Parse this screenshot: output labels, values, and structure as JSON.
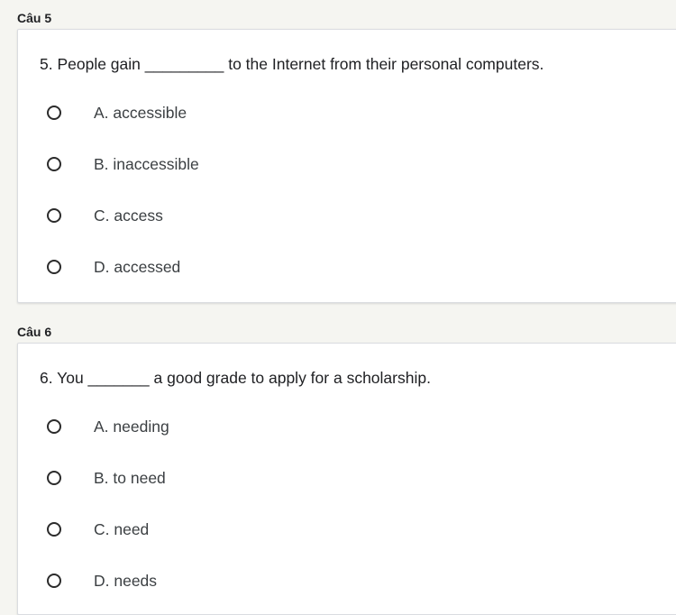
{
  "questions": [
    {
      "section_title": "Câu 5",
      "text": "5. People gain _________ to the Internet from their personal computers.",
      "options": [
        "A. accessible",
        "B. inaccessible",
        "C. access",
        "D. accessed"
      ]
    },
    {
      "section_title": "Câu 6",
      "text": "6. You _______ a good grade to apply for a scholarship.",
      "options": [
        "A. needing",
        "B. to need",
        "C. need",
        "D. needs"
      ]
    }
  ],
  "colors": {
    "page_background": "#f5f5f1",
    "card_background": "#ffffff",
    "card_border": "#dadce0",
    "radio_border": "#2b2b2b"
  }
}
